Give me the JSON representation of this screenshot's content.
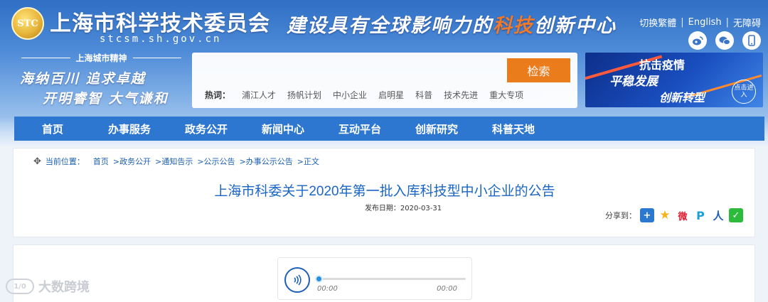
{
  "header": {
    "logo_emblem_text": "STC",
    "site_title": "上海市科学技术委员会",
    "site_url": "stcsm.sh.gov.cn",
    "slogan_part1": "建设具有全球影响力的",
    "slogan_highlight": "科技",
    "slogan_part2": "创新中心",
    "links": {
      "traditional": "切换繁體",
      "english": "English",
      "accessible": "无障碍",
      "separator": "|"
    },
    "social_icons": [
      "weibo-icon",
      "wechat-icon",
      "mobile-icon"
    ],
    "spirit": {
      "heading": "上海城市精神",
      "line1": "海纳百川 追求卓越",
      "line2": "开明睿智 大气谦和"
    }
  },
  "search": {
    "placeholder": "",
    "value": "",
    "button_label": "检索",
    "hot_label": "热词：",
    "hot_words": [
      "浦江人才",
      "扬帆计划",
      "中小企业",
      "启明星",
      "科普",
      "技术先进",
      "重大专项"
    ]
  },
  "banner": {
    "line1": "抗击疫情",
    "line2": "平稳发展",
    "line3": "创新转型",
    "enter_label": "点击进入"
  },
  "nav": {
    "items": [
      "首页",
      "办事服务",
      "政务公开",
      "新闻中心",
      "互动平台",
      "创新研究",
      "科普天地"
    ]
  },
  "breadcrumb": {
    "label": "当前位置：",
    "items": [
      "首页",
      ">政务公开",
      ">通知告示",
      ">公示公告",
      ">办事公示公告",
      ">正文"
    ]
  },
  "article": {
    "title": "上海市科委关于2020年第一批入库科技型中小企业的公告",
    "publish_date": "发布日期：2020-03-31",
    "share_label": "分享到："
  },
  "share_icons": [
    {
      "name": "share-plus-icon",
      "glyph": "+",
      "color": "#2b78d0"
    },
    {
      "name": "share-qzone-icon",
      "glyph": "★",
      "color": "#f3b51b"
    },
    {
      "name": "share-weibo-icon",
      "glyph": "微",
      "color": "#e6162d"
    },
    {
      "name": "share-pengyou-icon",
      "glyph": "P",
      "color": "#1aa0d8"
    },
    {
      "name": "share-renren-icon",
      "glyph": "人",
      "color": "#1f5fb2"
    },
    {
      "name": "share-wechat-icon",
      "glyph": "✓",
      "color": "#2dbb3c"
    }
  ],
  "audio": {
    "current_time": "00:00",
    "duration": "00:00",
    "progress": 0
  },
  "watermark": {
    "text": "大数跨境",
    "logo_text": "1/0"
  },
  "colors": {
    "nav_bg": "#2e77d0",
    "search_button": "#f07b14",
    "title_blue": "#1a66c4",
    "accent_orange": "#f07a2a"
  }
}
